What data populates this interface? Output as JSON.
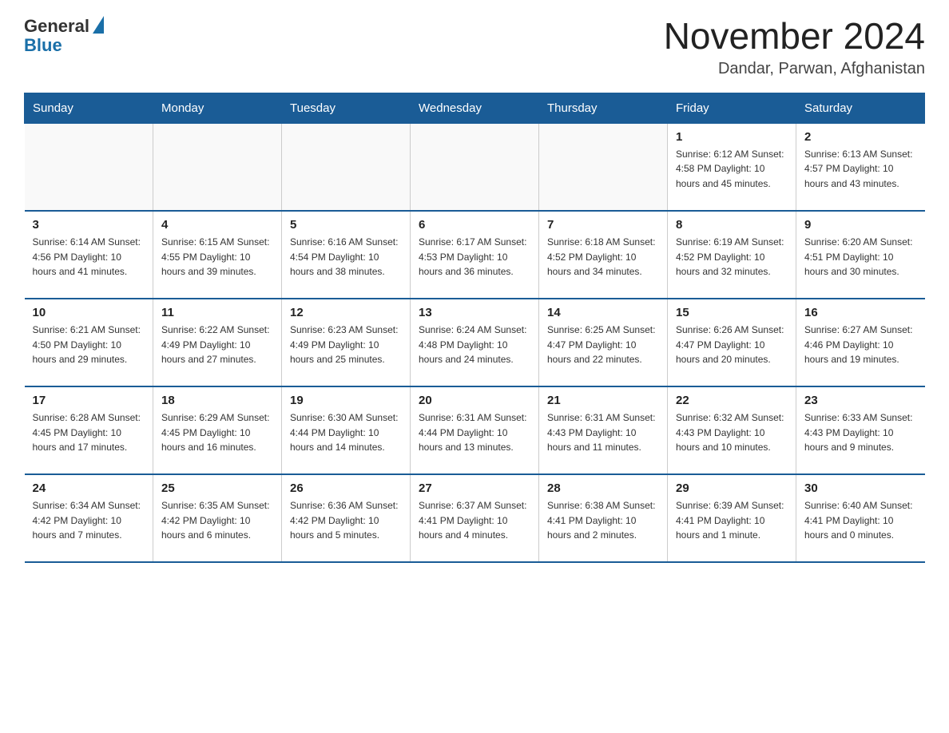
{
  "header": {
    "logo_text": "General",
    "logo_blue": "Blue",
    "month_title": "November 2024",
    "location": "Dandar, Parwan, Afghanistan"
  },
  "weekdays": [
    "Sunday",
    "Monday",
    "Tuesday",
    "Wednesday",
    "Thursday",
    "Friday",
    "Saturday"
  ],
  "weeks": [
    [
      {
        "day": "",
        "info": ""
      },
      {
        "day": "",
        "info": ""
      },
      {
        "day": "",
        "info": ""
      },
      {
        "day": "",
        "info": ""
      },
      {
        "day": "",
        "info": ""
      },
      {
        "day": "1",
        "info": "Sunrise: 6:12 AM\nSunset: 4:58 PM\nDaylight: 10 hours and 45 minutes."
      },
      {
        "day": "2",
        "info": "Sunrise: 6:13 AM\nSunset: 4:57 PM\nDaylight: 10 hours and 43 minutes."
      }
    ],
    [
      {
        "day": "3",
        "info": "Sunrise: 6:14 AM\nSunset: 4:56 PM\nDaylight: 10 hours and 41 minutes."
      },
      {
        "day": "4",
        "info": "Sunrise: 6:15 AM\nSunset: 4:55 PM\nDaylight: 10 hours and 39 minutes."
      },
      {
        "day": "5",
        "info": "Sunrise: 6:16 AM\nSunset: 4:54 PM\nDaylight: 10 hours and 38 minutes."
      },
      {
        "day": "6",
        "info": "Sunrise: 6:17 AM\nSunset: 4:53 PM\nDaylight: 10 hours and 36 minutes."
      },
      {
        "day": "7",
        "info": "Sunrise: 6:18 AM\nSunset: 4:52 PM\nDaylight: 10 hours and 34 minutes."
      },
      {
        "day": "8",
        "info": "Sunrise: 6:19 AM\nSunset: 4:52 PM\nDaylight: 10 hours and 32 minutes."
      },
      {
        "day": "9",
        "info": "Sunrise: 6:20 AM\nSunset: 4:51 PM\nDaylight: 10 hours and 30 minutes."
      }
    ],
    [
      {
        "day": "10",
        "info": "Sunrise: 6:21 AM\nSunset: 4:50 PM\nDaylight: 10 hours and 29 minutes."
      },
      {
        "day": "11",
        "info": "Sunrise: 6:22 AM\nSunset: 4:49 PM\nDaylight: 10 hours and 27 minutes."
      },
      {
        "day": "12",
        "info": "Sunrise: 6:23 AM\nSunset: 4:49 PM\nDaylight: 10 hours and 25 minutes."
      },
      {
        "day": "13",
        "info": "Sunrise: 6:24 AM\nSunset: 4:48 PM\nDaylight: 10 hours and 24 minutes."
      },
      {
        "day": "14",
        "info": "Sunrise: 6:25 AM\nSunset: 4:47 PM\nDaylight: 10 hours and 22 minutes."
      },
      {
        "day": "15",
        "info": "Sunrise: 6:26 AM\nSunset: 4:47 PM\nDaylight: 10 hours and 20 minutes."
      },
      {
        "day": "16",
        "info": "Sunrise: 6:27 AM\nSunset: 4:46 PM\nDaylight: 10 hours and 19 minutes."
      }
    ],
    [
      {
        "day": "17",
        "info": "Sunrise: 6:28 AM\nSunset: 4:45 PM\nDaylight: 10 hours and 17 minutes."
      },
      {
        "day": "18",
        "info": "Sunrise: 6:29 AM\nSunset: 4:45 PM\nDaylight: 10 hours and 16 minutes."
      },
      {
        "day": "19",
        "info": "Sunrise: 6:30 AM\nSunset: 4:44 PM\nDaylight: 10 hours and 14 minutes."
      },
      {
        "day": "20",
        "info": "Sunrise: 6:31 AM\nSunset: 4:44 PM\nDaylight: 10 hours and 13 minutes."
      },
      {
        "day": "21",
        "info": "Sunrise: 6:31 AM\nSunset: 4:43 PM\nDaylight: 10 hours and 11 minutes."
      },
      {
        "day": "22",
        "info": "Sunrise: 6:32 AM\nSunset: 4:43 PM\nDaylight: 10 hours and 10 minutes."
      },
      {
        "day": "23",
        "info": "Sunrise: 6:33 AM\nSunset: 4:43 PM\nDaylight: 10 hours and 9 minutes."
      }
    ],
    [
      {
        "day": "24",
        "info": "Sunrise: 6:34 AM\nSunset: 4:42 PM\nDaylight: 10 hours and 7 minutes."
      },
      {
        "day": "25",
        "info": "Sunrise: 6:35 AM\nSunset: 4:42 PM\nDaylight: 10 hours and 6 minutes."
      },
      {
        "day": "26",
        "info": "Sunrise: 6:36 AM\nSunset: 4:42 PM\nDaylight: 10 hours and 5 minutes."
      },
      {
        "day": "27",
        "info": "Sunrise: 6:37 AM\nSunset: 4:41 PM\nDaylight: 10 hours and 4 minutes."
      },
      {
        "day": "28",
        "info": "Sunrise: 6:38 AM\nSunset: 4:41 PM\nDaylight: 10 hours and 2 minutes."
      },
      {
        "day": "29",
        "info": "Sunrise: 6:39 AM\nSunset: 4:41 PM\nDaylight: 10 hours and 1 minute."
      },
      {
        "day": "30",
        "info": "Sunrise: 6:40 AM\nSunset: 4:41 PM\nDaylight: 10 hours and 0 minutes."
      }
    ]
  ]
}
